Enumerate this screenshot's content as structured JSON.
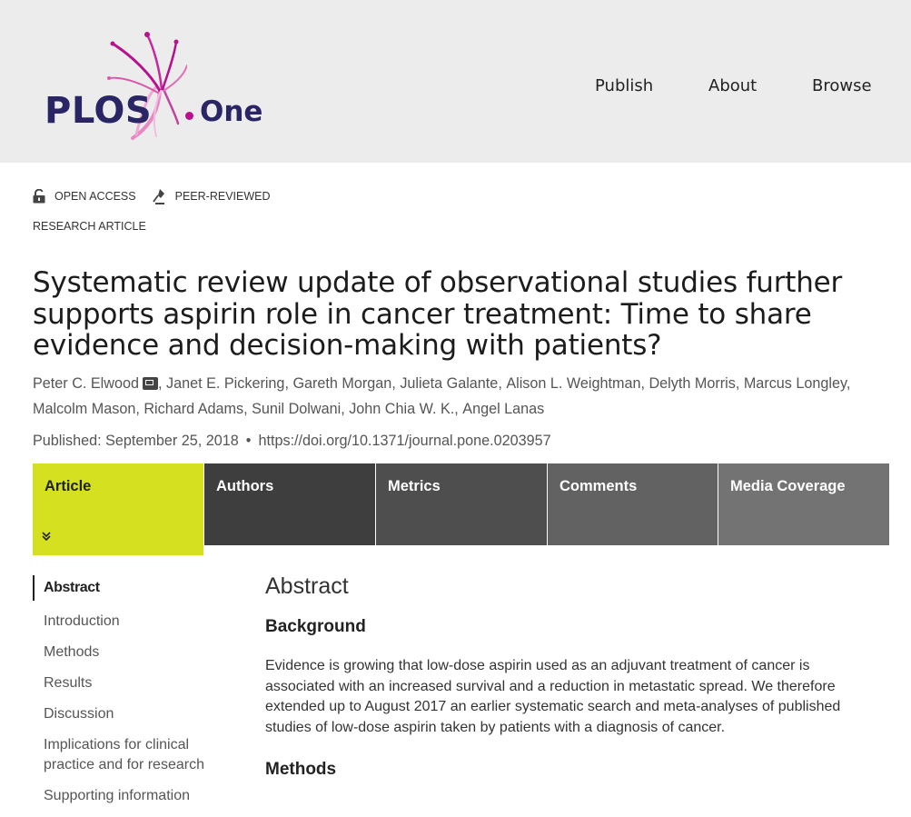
{
  "brand": {
    "name": "PLOS",
    "product": "One",
    "colors": {
      "navy": "#2a2665",
      "magenta": "#b7128e",
      "pink": "#e0519f",
      "tab_active": "#d5e120"
    }
  },
  "nav": {
    "publish": "Publish",
    "about": "About",
    "browse": "Browse"
  },
  "badges": {
    "open_access": "OPEN ACCESS",
    "peer_reviewed": "PEER-REVIEWED"
  },
  "article_type": "RESEARCH ARTICLE",
  "title": "Systematic review update of observational studies further supports aspirin role in cancer treatment: Time to share evidence and decision-making with patients?",
  "authors": [
    "Peter C. Elwood",
    "Janet E. Pickering",
    "Gareth Morgan",
    "Julieta Galante",
    "Alison L. Weightman",
    "Delyth Morris",
    "Marcus Longley",
    "Malcolm Mason",
    "Richard Adams",
    "Sunil Dolwani",
    "John Chia W. K.",
    "Angel Lanas"
  ],
  "published": {
    "date_text": "Published: September 25, 2018",
    "bullet": "•",
    "doi": "https://doi.org/10.1371/journal.pone.0203957"
  },
  "tabs": [
    {
      "label": "Article",
      "color": "#d5e120",
      "chevron": "»"
    },
    {
      "label": "Authors",
      "color": "#3e3e3e"
    },
    {
      "label": "Metrics",
      "color": "#4e4e4e"
    },
    {
      "label": "Comments",
      "color": "#626262"
    },
    {
      "label": "Media Coverage",
      "color": "#737373"
    }
  ],
  "sidenav": [
    "Abstract",
    "Introduction",
    "Methods",
    "Results",
    "Discussion",
    "Implications for clinical practice and for research",
    "Supporting information"
  ],
  "main": {
    "heading": "Abstract",
    "background_heading": "Background",
    "background_text": "Evidence is growing that low-dose aspirin used as an adjuvant treatment of cancer is associated with an increased survival and a reduction in metastatic spread. We therefore extended up to August 2017 an earlier systematic search and meta-analyses of published studies of low-dose aspirin taken by patients with a diagnosis of cancer.",
    "methods_heading": "Methods"
  }
}
